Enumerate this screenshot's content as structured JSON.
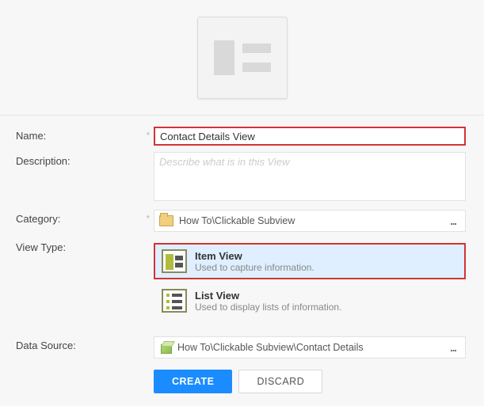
{
  "labels": {
    "name": "Name:",
    "description": "Description:",
    "category": "Category:",
    "viewType": "View Type:",
    "dataSource": "Data Source:"
  },
  "fields": {
    "name": {
      "value": "Contact Details View"
    },
    "description": {
      "value": "",
      "placeholder": "Describe what is in this View"
    },
    "category": {
      "value": "How To\\Clickable Subview"
    },
    "dataSource": {
      "value": "How To\\Clickable Subview\\Contact Details"
    }
  },
  "picker": {
    "ellipsis": "..."
  },
  "viewTypes": [
    {
      "key": "item",
      "title": "Item View",
      "subtitle": "Used to capture information.",
      "selected": true
    },
    {
      "key": "list",
      "title": "List View",
      "subtitle": "Used to display lists of information.",
      "selected": false
    }
  ],
  "buttons": {
    "create": "CREATE",
    "discard": "DISCARD"
  }
}
